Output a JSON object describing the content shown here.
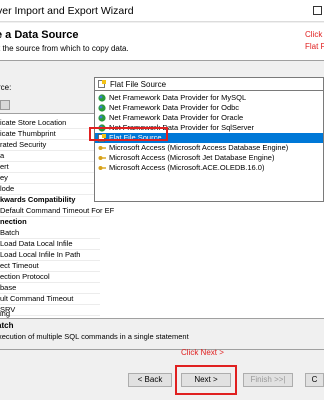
{
  "window": {
    "title": "ver Import and Export Wizard"
  },
  "header": {
    "title": "e a Data Source",
    "subtitle": "t the source from which to copy data.",
    "annotation_lines": [
      "Click",
      "Flat F"
    ]
  },
  "source": {
    "label": "rce:",
    "selected": "Flat File Source"
  },
  "dropdown": {
    "items": [
      {
        "label": "Net Framework Data Provider for MySQL",
        "icon": "globe-icon"
      },
      {
        "label": "Net Framework Data Provider for Odbc",
        "icon": "globe-icon"
      },
      {
        "label": "Net Framework Data Provider for Oracle",
        "icon": "globe-icon"
      },
      {
        "label": "Net Framework Data Provider for SqlServer",
        "icon": "globe-icon"
      },
      {
        "label": "Flat File Source",
        "icon": "flat-file-icon",
        "selected": true
      },
      {
        "label": "Microsoft Access (Microsoft Access Database Engine)",
        "icon": "key-icon"
      },
      {
        "label": "Microsoft Access (Microsoft Jet Database Engine)",
        "icon": "key-icon"
      },
      {
        "label": "Microsoft Access (Microsoft.ACE.OLEDB.16.0)",
        "icon": "key-icon"
      }
    ]
  },
  "grid": {
    "rows": [
      {
        "text": "icate Store Location",
        "cat": false
      },
      {
        "text": "icate Thumbprint",
        "cat": false
      },
      {
        "text": "rated Security",
        "cat": false
      },
      {
        "text": "a",
        "cat": false
      },
      {
        "text": "ert",
        "cat": false
      },
      {
        "text": "ey",
        "cat": false
      },
      {
        "text": "lode",
        "cat": false
      },
      {
        "text": "kwards Compatibility",
        "cat": true
      },
      {
        "text": "Default Command Timeout For EF",
        "cat": false
      },
      {
        "text": "nection",
        "cat": true
      },
      {
        "text": "Batch",
        "cat": false
      },
      {
        "text": "Load Data Local Infile",
        "cat": false
      },
      {
        "text": "Load Local Infile In Path",
        "cat": false
      },
      {
        "text": "ect Timeout",
        "cat": false
      },
      {
        "text": "ection Protocol",
        "cat": false
      },
      {
        "text": "base",
        "cat": false
      },
      {
        "text": "ult Command Timeout",
        "cat": false
      },
      {
        "text": "SRV",
        "cat": false
      },
      {
        "text": "ing",
        "cat": false
      }
    ]
  },
  "description": {
    "title": "atch",
    "text": "xecution of multiple SQL commands in a single statement"
  },
  "annotation_next": "Click Next >",
  "buttons": {
    "back": "< Back",
    "next": "Next >",
    "finish": "Finish >>|",
    "cancel": "C"
  },
  "colors": {
    "selection": "#0078d7",
    "annotation_red": "#e02020"
  }
}
